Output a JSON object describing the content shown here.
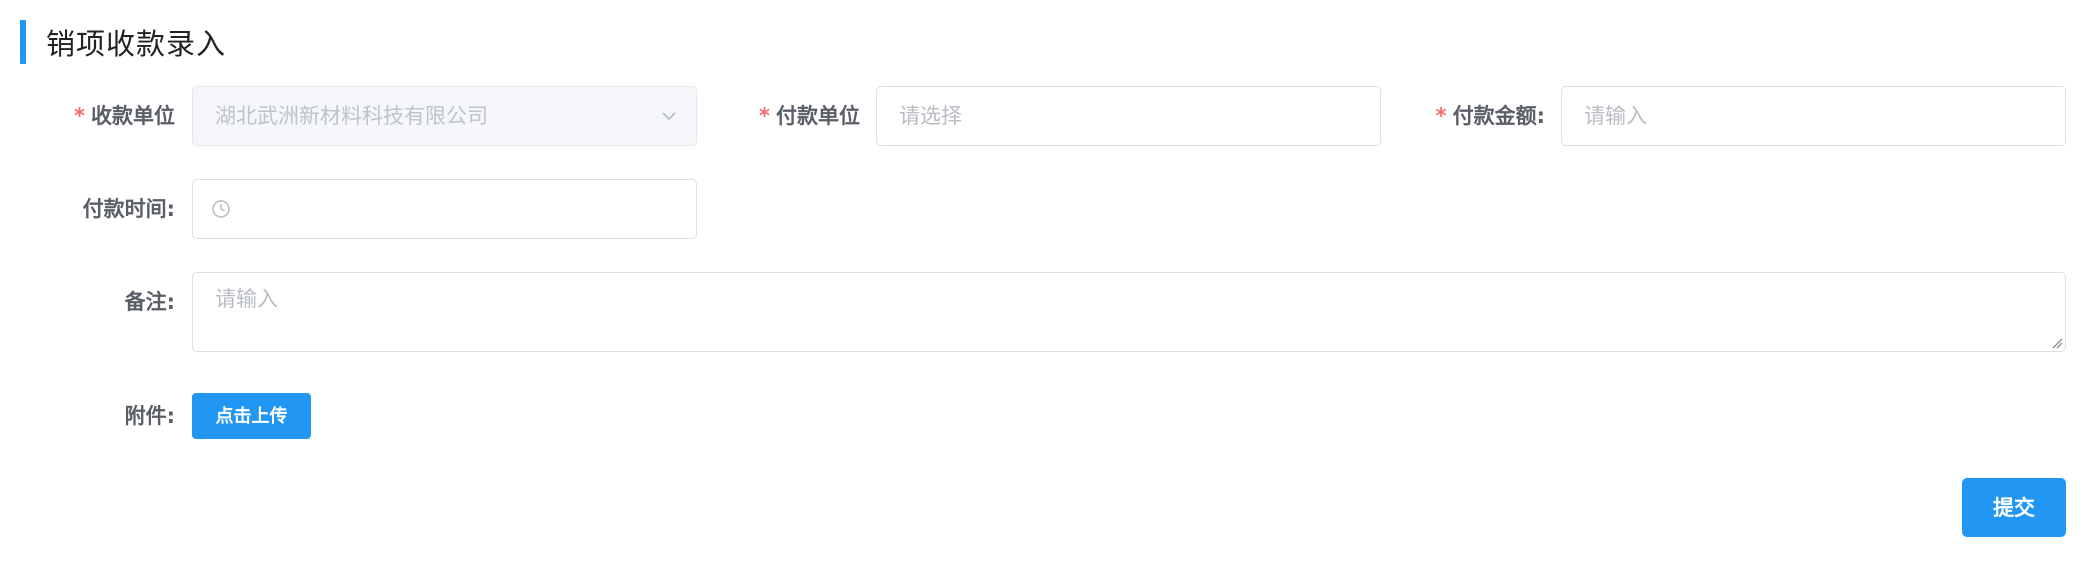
{
  "page": {
    "title": "销项收款录入"
  },
  "form": {
    "receiver": {
      "required_mark": "*",
      "label": "收款单位",
      "value": "湖北武洲新材料科技有限公司",
      "icon": "chevron-down-icon"
    },
    "payer": {
      "required_mark": "*",
      "label": "付款单位",
      "placeholder": "请选择"
    },
    "amount": {
      "required_mark": "*",
      "label": "付款金额:",
      "placeholder": "请输入"
    },
    "pay_time": {
      "label": "付款时间:",
      "icon": "clock-icon"
    },
    "remark": {
      "label": "备注:",
      "placeholder": "请输入"
    },
    "attachment": {
      "label": "附件:",
      "upload_label": "点击上传"
    },
    "submit_label": "提交"
  },
  "colors": {
    "primary": "#2196f3",
    "required": "#f56c6c",
    "border": "#dcdfe6",
    "disabled_bg": "#f5f7fa"
  }
}
